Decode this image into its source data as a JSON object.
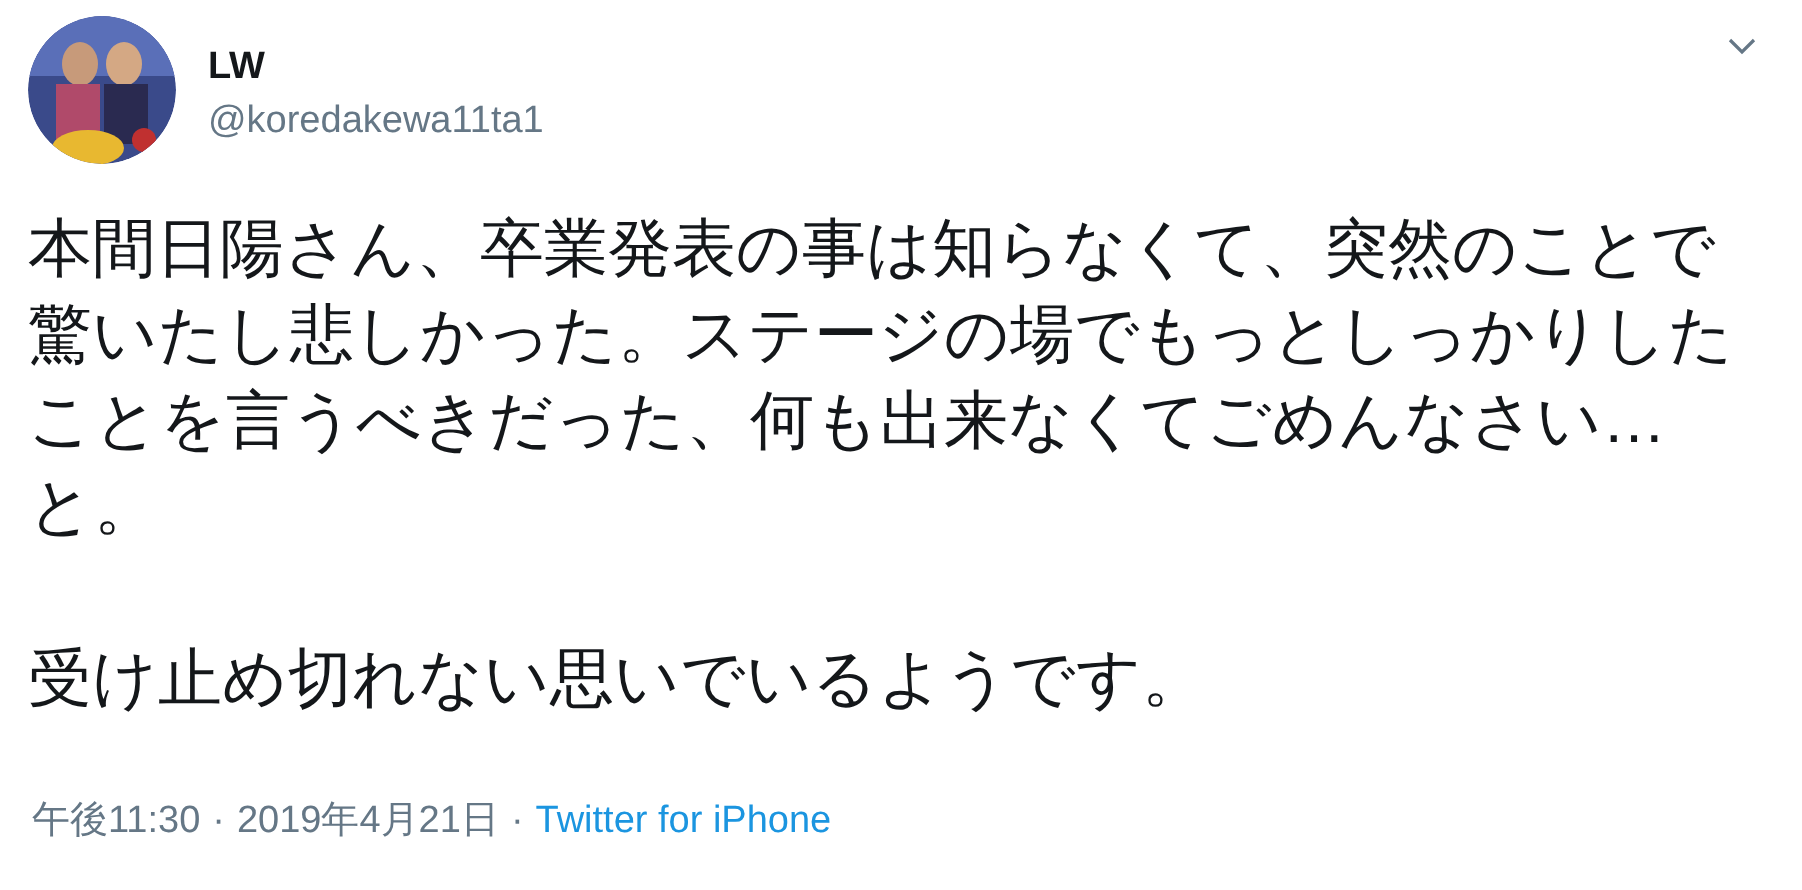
{
  "tweet": {
    "author": {
      "name": "LW",
      "handle": "@koredakewa11ta1"
    },
    "paragraphs": [
      "本間日陽さん、卒業発表の事は知らなくて、突然のことで驚いたし悲しかった。ステージの場でもっとしっかりしたことを言うべきだった、何も出来なくてごめんなさい… と。",
      "受け止め切れない思いでいるようです。"
    ],
    "meta": {
      "time": "午後11:30",
      "separator": "·",
      "date": "2019年4月21日",
      "source": "Twitter for iPhone"
    }
  }
}
